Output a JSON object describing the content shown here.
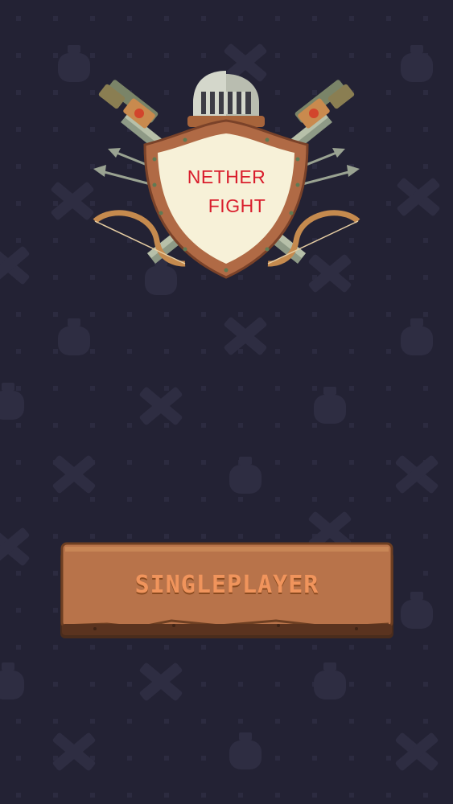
{
  "logo": {
    "line1": "NETHER",
    "line2": "FIGHT"
  },
  "menu": {
    "singleplayer_label": "SINGLEPLAYER"
  },
  "colors": {
    "background": "#232234",
    "pattern": "#2e2d42",
    "title_text": "#d91d2c",
    "button_wood": "#b8734a",
    "button_text": "#f0945c"
  }
}
